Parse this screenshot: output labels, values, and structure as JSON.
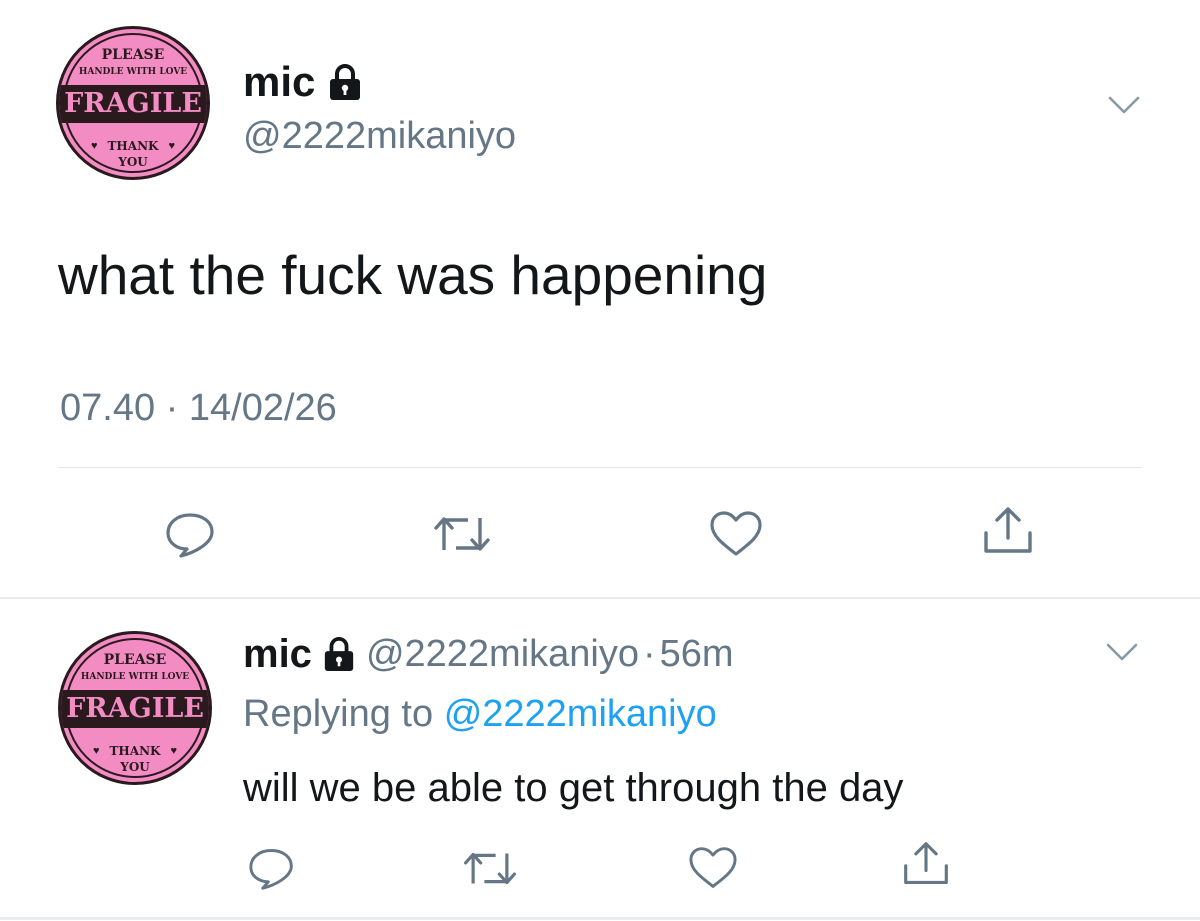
{
  "main_tweet": {
    "avatar": {
      "line1": "PLEASE",
      "line2": "HANDLE WITH LOVE",
      "band": "FRAGILE",
      "line3": "THANK",
      "line4": "YOU"
    },
    "display_name": "mic",
    "handle": "@2222mikaniyo",
    "text": "what the fuck was happening",
    "timestamp": "07.40 · 14/02/26",
    "icons": [
      "lock-icon",
      "chevron-down-icon",
      "reply-icon",
      "retweet-icon",
      "like-icon",
      "share-icon"
    ]
  },
  "reply_tweet": {
    "avatar": {
      "line1": "PLEASE",
      "line2": "HANDLE WITH LOVE",
      "band": "FRAGILE",
      "line3": "THANK",
      "line4": "YOU"
    },
    "display_name": "mic",
    "handle": "@2222mikaniyo",
    "separator": "·",
    "time_ago": "56m",
    "replying_prefix": "Replying to",
    "replying_handle": "@2222mikaniyo",
    "text": "will we be able to get through the day"
  },
  "colors": {
    "link": "#1da1f2",
    "muted": "#657786",
    "avatar_pink": "#f48cc4",
    "avatar_dark": "#2a1a1e"
  }
}
